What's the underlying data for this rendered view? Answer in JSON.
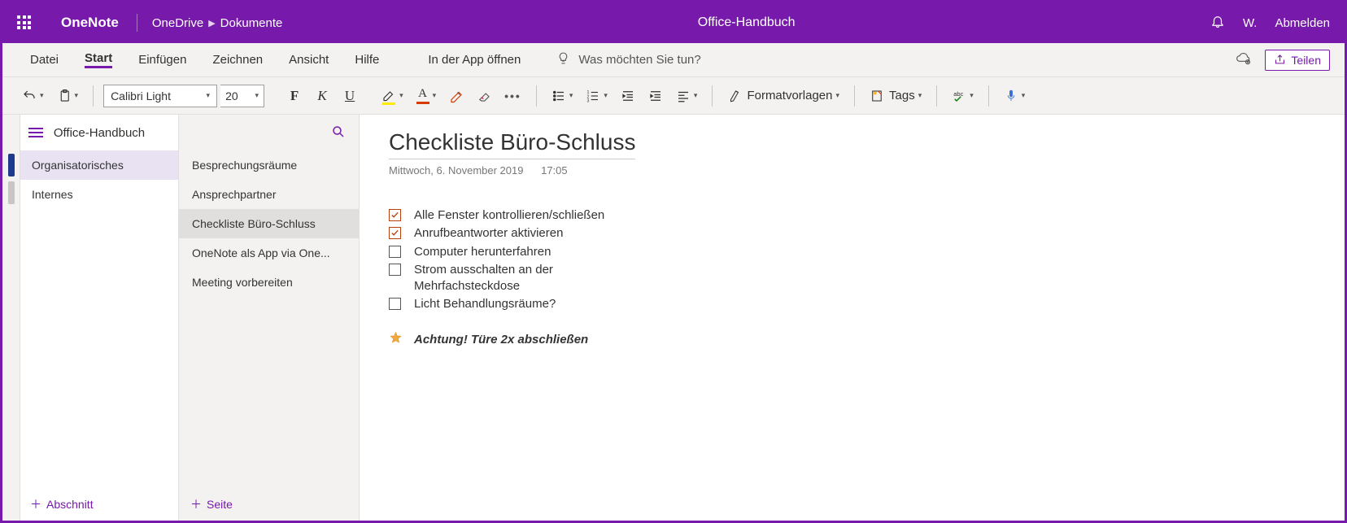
{
  "titlebar": {
    "app": "OneNote",
    "breadcrumb": [
      "OneDrive",
      "Dokumente"
    ],
    "document": "Office-Handbuch",
    "user_initial": "W.",
    "signout": "Abmelden"
  },
  "ribbon": {
    "tabs": [
      "Datei",
      "Start",
      "Einfügen",
      "Zeichnen",
      "Ansicht",
      "Hilfe"
    ],
    "active_index": 1,
    "open_in_app": "In der App öffnen",
    "tell_me": "Was möchten Sie tun?",
    "share": "Teilen"
  },
  "toolbar": {
    "font": "Calibri Light",
    "size": "20",
    "styles": "Formatvorlagen",
    "tags": "Tags"
  },
  "notebook": {
    "title": "Office-Handbuch",
    "sections": [
      "Organisatorisches",
      "Internes"
    ],
    "active_section": 0,
    "add_section": "Abschnitt",
    "pages": [
      "Besprechungsräume",
      "Ansprechpartner",
      "Checkliste Büro-Schluss",
      "OneNote als App via One...",
      "Meeting vorbereiten"
    ],
    "active_page": 2,
    "add_page": "Seite"
  },
  "note": {
    "title": "Checkliste Büro-Schluss",
    "date": "Mittwoch, 6. November 2019",
    "time": "17:05",
    "checklist": [
      {
        "checked": true,
        "text": "Alle Fenster kontrollieren/schließen"
      },
      {
        "checked": true,
        "text": "Anrufbeantworter aktivieren"
      },
      {
        "checked": false,
        "text": "Computer herunterfahren"
      },
      {
        "checked": false,
        "text": "Strom ausschalten an der Mehrfachsteckdose"
      },
      {
        "checked": false,
        "text": "Licht Behandlungsräume?"
      }
    ],
    "warning": "Achtung! Türe 2x abschließen"
  }
}
